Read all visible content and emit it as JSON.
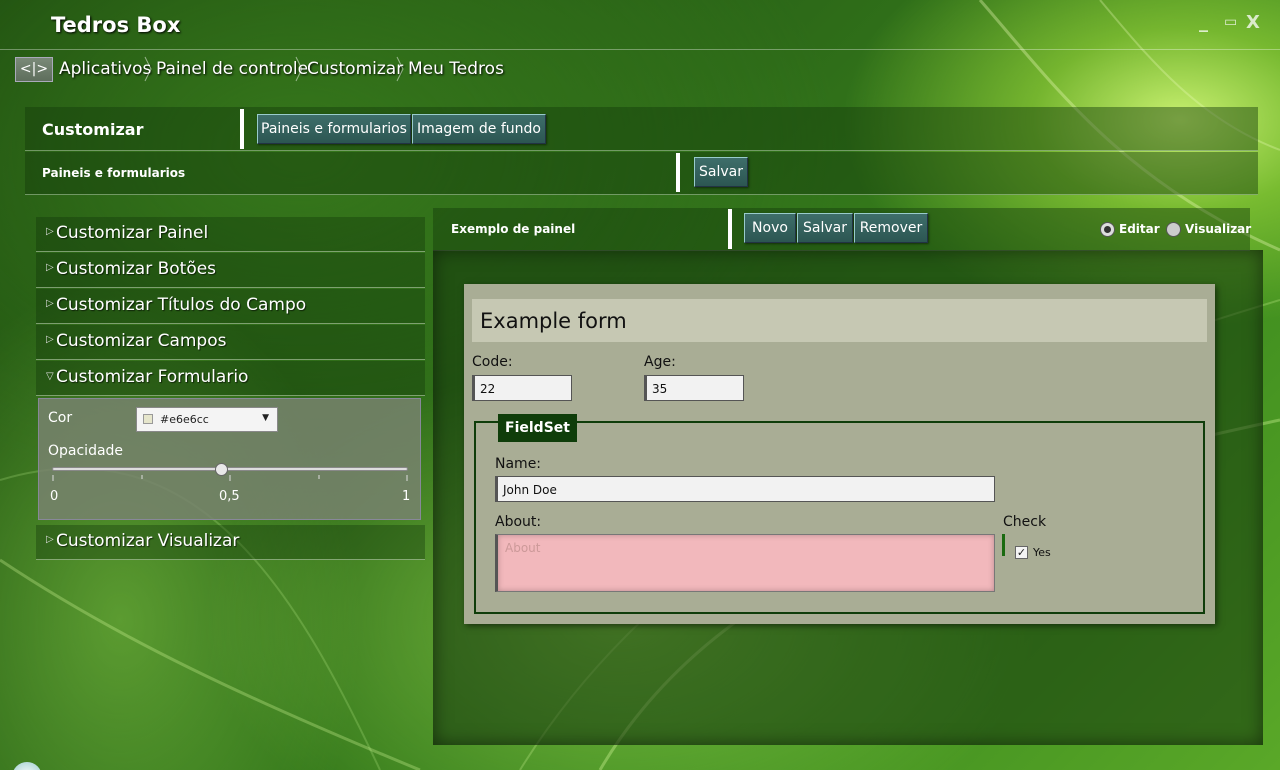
{
  "app": {
    "title": "Tedros Box"
  },
  "window_controls": {
    "minimize": "_",
    "maximize": "▭",
    "close": "X"
  },
  "breadcrumb": {
    "back_label": "<|>",
    "items": [
      "Aplicativos",
      "Painel de controle",
      "Customizar",
      "Meu Tedros"
    ]
  },
  "header": {
    "title": "Customizar",
    "tabs": [
      "Paineis e formularios",
      "Imagem de fundo"
    ]
  },
  "subheader": {
    "title": "Paineis e formularios",
    "save_label": "Salvar"
  },
  "sidebar": {
    "items": [
      {
        "label": "Customizar Painel",
        "expanded": false
      },
      {
        "label": "Customizar Botões",
        "expanded": false
      },
      {
        "label": "Customizar Títulos do Campo",
        "expanded": false
      },
      {
        "label": "Customizar Campos",
        "expanded": false
      },
      {
        "label": "Customizar Formulario",
        "expanded": true
      },
      {
        "label": "Customizar Visualizar",
        "expanded": false
      }
    ],
    "form_settings": {
      "color_label": "Cor",
      "color_value": "#e6e6cc",
      "opacity_label": "Opacidade",
      "opacity_value": 0.5,
      "ticks": [
        "0",
        "0,5",
        "1"
      ]
    }
  },
  "example_panel": {
    "title": "Exemplo de painel",
    "buttons": [
      "Novo",
      "Salvar",
      "Remover"
    ],
    "mode_options": [
      "Editar",
      "Visualizar"
    ],
    "selected_mode": "Editar"
  },
  "example_form": {
    "title": "Example form",
    "code_label": "Code:",
    "code_value": "22",
    "age_label": "Age:",
    "age_value": "35",
    "fieldset_label": "FieldSet",
    "name_label": "Name:",
    "name_value": "John Doe",
    "about_label": "About:",
    "about_placeholder": "About",
    "check_label": "Check",
    "check_option": "Yes",
    "check_checked": true
  },
  "colors": {
    "button_bg": "#2f5d5a",
    "form_bg": "#a9ad95",
    "form_header_bg": "#c6c8b3",
    "fieldset_border": "#0f3d0a",
    "textarea_bg": "#f2b8bc"
  }
}
